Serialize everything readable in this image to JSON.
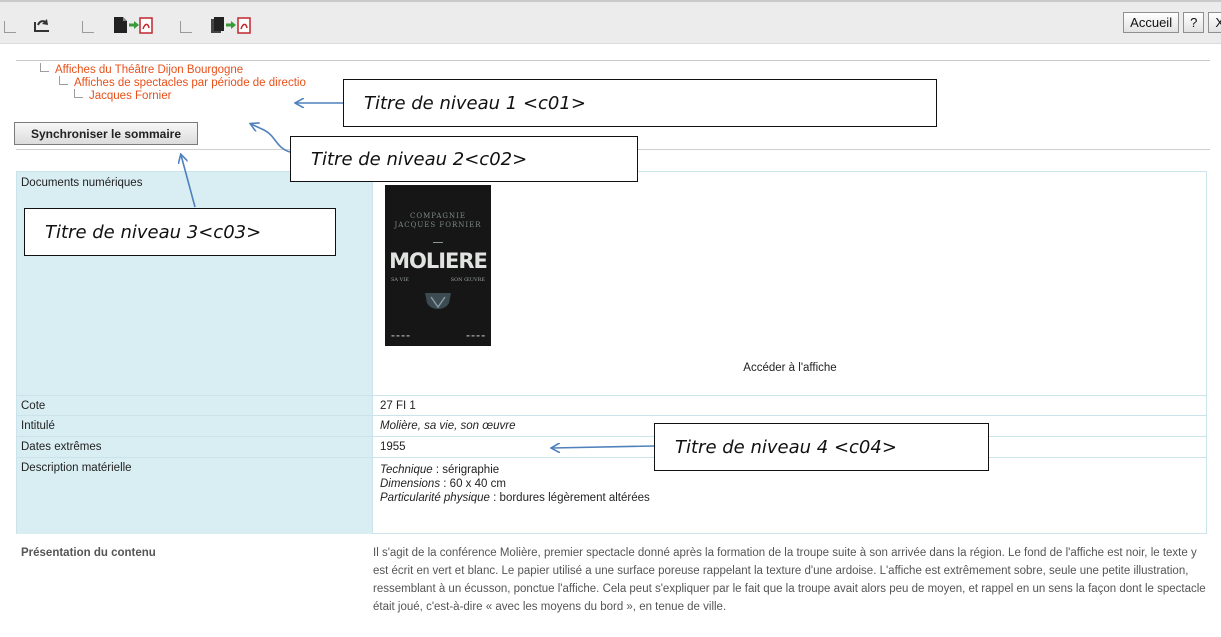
{
  "toolbar": {
    "icons": [
      "refresh-icon",
      "export-pdf-icon",
      "export-all-pdf-icon"
    ],
    "links": [
      {
        "label": "Accueil"
      },
      {
        "label": "?"
      },
      {
        "label": "X"
      }
    ]
  },
  "tree": {
    "items": [
      {
        "label": "Affiches du Théâtre Dijon Bourgogne"
      },
      {
        "label": "Affiches de spectacles par période de directio"
      },
      {
        "label": "Jacques Fornier"
      }
    ],
    "sync_button": "Synchroniser le sommaire"
  },
  "record": {
    "documents_label": "Documents numériques",
    "poster": {
      "line1": "COMPAGNIE",
      "line2": "JACQUES FORNIER",
      "title": "MOLIERE",
      "sub_left": "SA VIE",
      "sub_right": "SON ŒUVRE"
    },
    "access_link": "Accéder à l'affiche",
    "fields": [
      {
        "label": "Cote",
        "value": "27 FI 1"
      },
      {
        "label": "Intitulé",
        "value": "Molière, sa vie, son œuvre"
      },
      {
        "label": "Dates extrêmes",
        "value": "1955"
      }
    ],
    "description": {
      "label": "Description matérielle",
      "lines": [
        {
          "key": "Technique",
          "sep": " : ",
          "value": "sérigraphie"
        },
        {
          "key": "Dimensions",
          "sep": " : ",
          "value": "60 x 40 cm"
        },
        {
          "key": "Particularité physique",
          "sep": " : ",
          "value": "bordures légèrement altérées"
        }
      ]
    }
  },
  "presentation": {
    "label": "Présentation du contenu",
    "text": "Il s'agit de la conférence Molière, premier spectacle donné après la formation de la troupe suite à son arrivée dans la région. Le fond de l'affiche est noir, le texte y est écrit en vert et blanc. Le papier utilisé a une surface poreuse rappelant la texture d'une ardoise. L'affiche est extrêmement sobre, seule une petite illustration, ressemblant à un écusson, ponctue l'affiche. Cela peut s'expliquer par le fait que la troupe avait alors peu de moyen, et rappel en un sens la façon dont le spectacle était joué, c'est-à-dire « avec les moyens du bord », en tenue de ville."
  },
  "annotations": [
    {
      "text": "Titre de niveau 1 <c01>"
    },
    {
      "text": "Titre de niveau 2<c02>"
    },
    {
      "text": "Titre de niveau 3<c03>"
    },
    {
      "text": "Titre de niveau 4 <c04>"
    }
  ],
  "colors": {
    "tree_link": "#e8501a",
    "label_bg": "#d9eef3",
    "arrow": "#4f81bd"
  }
}
